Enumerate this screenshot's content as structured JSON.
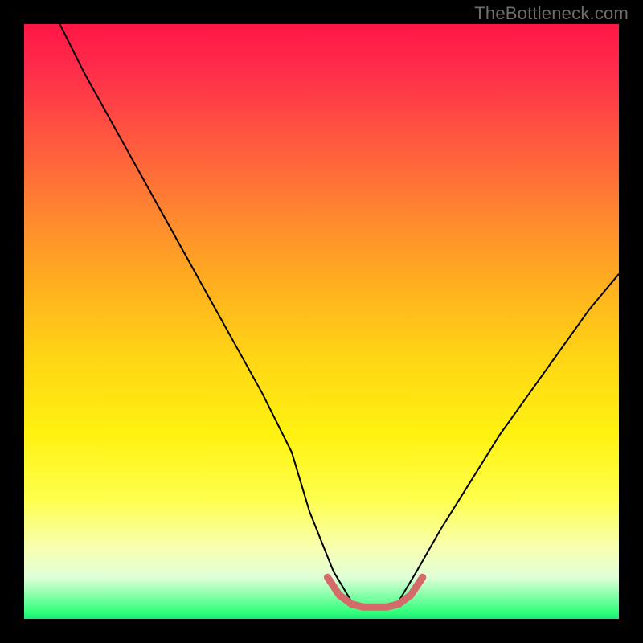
{
  "watermark": "TheBottleneck.com",
  "chart_data": {
    "type": "line",
    "title": "",
    "xlabel": "",
    "ylabel": "",
    "xlim": [
      0,
      100
    ],
    "ylim": [
      0,
      100
    ],
    "gradient_stops": [
      {
        "pct": 0,
        "color": "#ff1646"
      },
      {
        "pct": 8,
        "color": "#ff2e4a"
      },
      {
        "pct": 20,
        "color": "#ff5a3f"
      },
      {
        "pct": 33,
        "color": "#ff8a2e"
      },
      {
        "pct": 45,
        "color": "#ffb31e"
      },
      {
        "pct": 57,
        "color": "#ffd815"
      },
      {
        "pct": 69,
        "color": "#fff210"
      },
      {
        "pct": 80,
        "color": "#feff4e"
      },
      {
        "pct": 88,
        "color": "#f8ffb0"
      },
      {
        "pct": 93,
        "color": "#e0ffd8"
      },
      {
        "pct": 99,
        "color": "#2eff7a"
      },
      {
        "pct": 100,
        "color": "#1de879"
      }
    ],
    "series": [
      {
        "name": "bottleneck-curve",
        "color": "#000000",
        "stroke_width": 2,
        "x": [
          6,
          10,
          15,
          20,
          25,
          30,
          35,
          40,
          45,
          48,
          52,
          55,
          58,
          60,
          63,
          66,
          70,
          75,
          80,
          85,
          90,
          95,
          100
        ],
        "y": [
          100,
          92,
          83,
          74,
          65,
          56,
          47,
          38,
          28,
          18,
          8,
          3,
          2,
          2,
          3,
          8,
          15,
          23,
          31,
          38,
          45,
          52,
          58
        ]
      },
      {
        "name": "sweet-spot-band",
        "color": "#d46a6a",
        "stroke_width": 9,
        "stroke_linecap": "round",
        "x": [
          51,
          53,
          55,
          57,
          59,
          61,
          63,
          65,
          67
        ],
        "y": [
          7,
          4,
          2.5,
          2,
          2,
          2,
          2.5,
          4,
          7
        ]
      }
    ]
  }
}
